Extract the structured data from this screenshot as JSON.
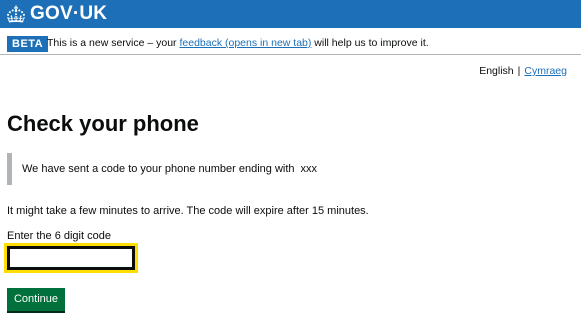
{
  "header": {
    "logo_text": "GOV·UK",
    "crown_icon": "crown-icon"
  },
  "phase_banner": {
    "tag": "BETA",
    "text_before": "This is a new service – your ",
    "link_text": "feedback (opens in new tab)",
    "text_after": " will help us to improve it."
  },
  "language": {
    "current": "English",
    "separator": "|",
    "other": "Cymraeg"
  },
  "page": {
    "title": "Check your phone",
    "inset_text": "We have sent a code to your phone number ending with",
    "phone_suffix": "xxx",
    "body_text": "It might take a few minutes to arrive. The code will expire after 15 minutes.",
    "input_label": "Enter the 6 digit code",
    "input_value": "",
    "continue_label": "Continue"
  },
  "colors": {
    "brand_blue": "#1d70b8",
    "button_green": "#00703c",
    "focus_yellow": "#ffdd00",
    "inset_border": "#b1b4b6"
  }
}
